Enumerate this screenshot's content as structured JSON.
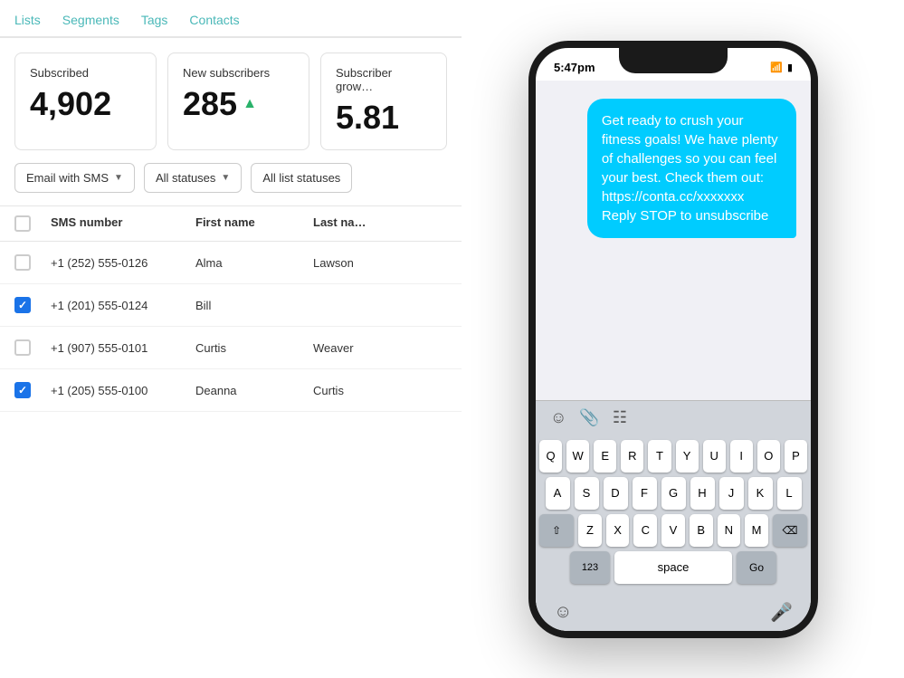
{
  "nav": {
    "tabs": [
      {
        "label": "Lists",
        "active": false
      },
      {
        "label": "Segments",
        "active": false
      },
      {
        "label": "Tags",
        "active": false
      },
      {
        "label": "Contacts",
        "active": false
      }
    ]
  },
  "stats": {
    "subscribed": {
      "label": "Subscribed",
      "value": "4,902"
    },
    "new_subscribers": {
      "label": "New subscribers",
      "value": "285"
    },
    "subscriber_growth": {
      "label": "Subscriber grow…",
      "value": "5.81"
    }
  },
  "filters": {
    "type": "Email with SMS",
    "status": "All statuses",
    "list_status": "All list statuses"
  },
  "table": {
    "headers": [
      "",
      "SMS number",
      "First name",
      "Last na…"
    ],
    "rows": [
      {
        "checked": false,
        "phone": "+1 (252) 555-0126",
        "first": "Alma",
        "last": "Lawson"
      },
      {
        "checked": true,
        "phone": "+1 (201) 555-0124",
        "first": "Bill",
        "last": ""
      },
      {
        "checked": false,
        "phone": "+1 (907) 555-0101",
        "first": "Curtis",
        "last": "Weaver"
      },
      {
        "checked": true,
        "phone": "+1 (205) 555-0100",
        "first": "Deanna",
        "last": "Curtis"
      }
    ]
  },
  "phone": {
    "status_bar": {
      "time": "5:47pm",
      "wifi_icon": "wifi",
      "battery_icon": "battery"
    },
    "message": "Get ready to crush your fitness goals! We have plenty of challenges so you can feel your best. Check them out: https://conta.cc/xxxxxxx Reply STOP to unsubscribe",
    "keyboard": {
      "rows": [
        [
          "Q",
          "W",
          "E",
          "R",
          "T",
          "Y",
          "U",
          "I",
          "O",
          "P"
        ],
        [
          "A",
          "S",
          "D",
          "F",
          "G",
          "H",
          "J",
          "K",
          "L"
        ],
        [
          "⇧",
          "Z",
          "X",
          "C",
          "V",
          "B",
          "N",
          "M",
          "⌫"
        ]
      ],
      "bottom": [
        "123",
        "space",
        "Go"
      ]
    }
  }
}
